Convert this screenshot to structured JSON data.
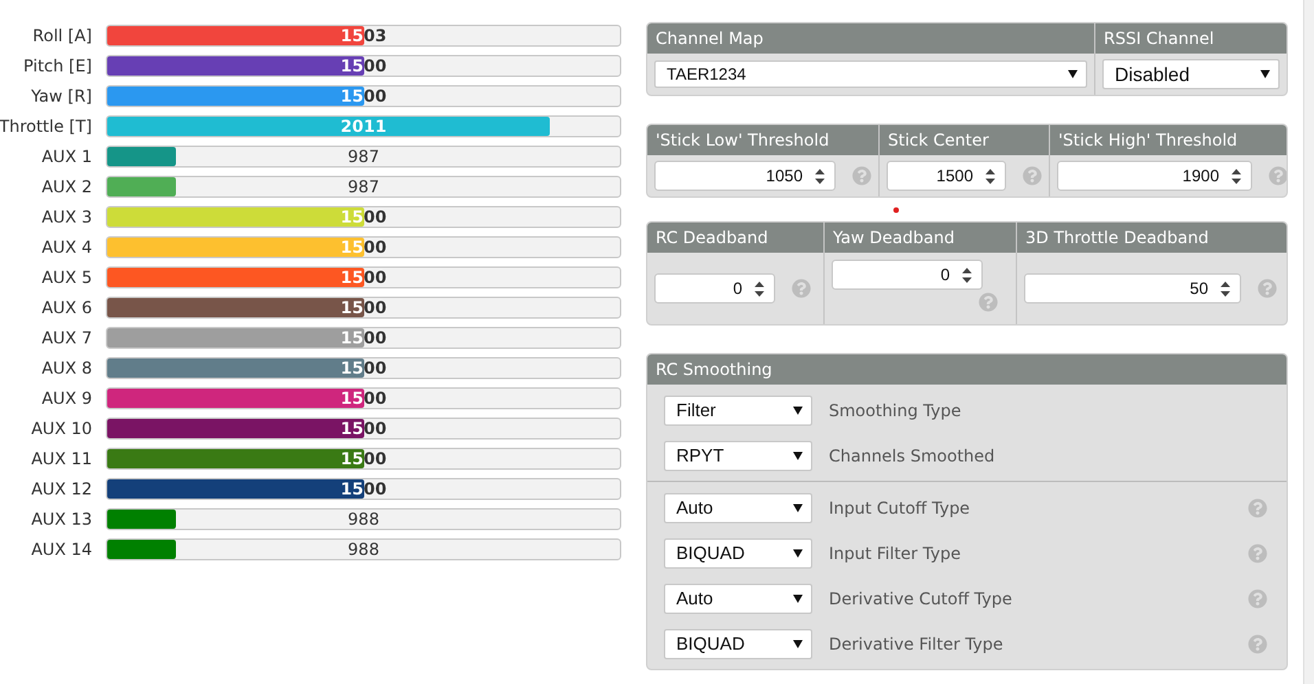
{
  "channels": [
    {
      "name": "Roll [A]",
      "value": "1503",
      "level": 0.5,
      "color": "#f1453d"
    },
    {
      "name": "Pitch [E]",
      "value": "1500",
      "level": 0.5,
      "color": "#673fb4"
    },
    {
      "name": "Yaw [R]",
      "value": "1500",
      "level": 0.5,
      "color": "#2b98f0"
    },
    {
      "name": "Throttle [T]",
      "value": "2011",
      "level": 0.862,
      "color": "#1fbcd2"
    },
    {
      "name": "AUX 1",
      "value": "987",
      "level": 0.134,
      "color": "#159588"
    },
    {
      "name": "AUX 2",
      "value": "987",
      "level": 0.134,
      "color": "#50ae55"
    },
    {
      "name": "AUX 3",
      "value": "1500",
      "level": 0.5,
      "color": "#cddc39"
    },
    {
      "name": "AUX 4",
      "value": "1500",
      "level": 0.5,
      "color": "#fdc02f"
    },
    {
      "name": "AUX 5",
      "value": "1500",
      "level": 0.5,
      "color": "#fd5722"
    },
    {
      "name": "AUX 6",
      "value": "1500",
      "level": 0.5,
      "color": "#785549"
    },
    {
      "name": "AUX 7",
      "value": "1500",
      "level": 0.5,
      "color": "#9e9e9e"
    },
    {
      "name": "AUX 8",
      "value": "1500",
      "level": 0.5,
      "color": "#617d8a"
    },
    {
      "name": "AUX 9",
      "value": "1500",
      "level": 0.5,
      "color": "#cf267d"
    },
    {
      "name": "AUX 10",
      "value": "1500",
      "level": 0.5,
      "color": "#7a1464"
    },
    {
      "name": "AUX 11",
      "value": "1500",
      "level": 0.5,
      "color": "#3a7a14"
    },
    {
      "name": "AUX 12",
      "value": "1500",
      "level": 0.5,
      "color": "#14407a"
    },
    {
      "name": "AUX 13",
      "value": "988",
      "level": 0.134,
      "color": "#008000"
    },
    {
      "name": "AUX 14",
      "value": "988",
      "level": 0.134,
      "color": "#008000"
    }
  ],
  "channel_map_panel": {
    "columns": [
      {
        "heading": "Channel Map",
        "value": "TAER1234"
      },
      {
        "heading": "RSSI Channel",
        "value": "Disabled"
      }
    ]
  },
  "thresholds": {
    "columns": [
      {
        "heading": "'Stick Low' Threshold",
        "value": "1050",
        "kind": "inline"
      },
      {
        "heading": "Stick Center",
        "value": "1500",
        "kind": "inline"
      },
      {
        "heading": "'Stick High' Threshold",
        "value": "1900",
        "kind": "inline"
      }
    ]
  },
  "deadbands": {
    "columns": [
      {
        "heading": "RC Deadband",
        "value": "0",
        "kind": "inline"
      },
      {
        "heading": "Yaw Deadband",
        "value": "0",
        "kind": "stacked"
      },
      {
        "heading": "3D Throttle Deadband",
        "value": "50",
        "kind": "inline"
      }
    ]
  },
  "rc_smoothing": {
    "title": "RC Smoothing",
    "groups": [
      [
        {
          "value": "Filter",
          "label": "Smoothing Type",
          "help": false
        },
        {
          "value": "RPYT",
          "label": "Channels Smoothed",
          "help": false
        }
      ],
      [
        {
          "value": "Auto",
          "label": "Input Cutoff Type",
          "help": true
        },
        {
          "value": "BIQUAD",
          "label": "Input Filter Type",
          "help": true
        },
        {
          "value": "Auto",
          "label": "Derivative Cutoff Type",
          "help": true
        },
        {
          "value": "BIQUAD",
          "label": "Derivative Filter Type",
          "help": true
        }
      ]
    ]
  }
}
